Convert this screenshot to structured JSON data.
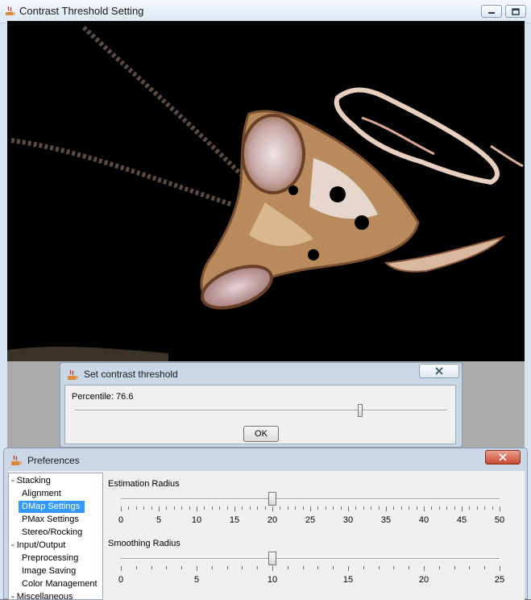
{
  "main_window": {
    "title": "Contrast Threshold Setting"
  },
  "contrast_dialog": {
    "title": "Set contrast threshold",
    "percentile_label": "Percentile: 76.6",
    "percentile_value": 76.6,
    "ok_label": "OK"
  },
  "preferences": {
    "title": "Preferences",
    "tree": [
      {
        "label": "- Stacking",
        "indent": 0,
        "selected": false
      },
      {
        "label": "Alignment",
        "indent": 1,
        "selected": false
      },
      {
        "label": "DMap Settings",
        "indent": 1,
        "selected": true
      },
      {
        "label": "PMax Settings",
        "indent": 1,
        "selected": false
      },
      {
        "label": "Stereo/Rocking",
        "indent": 1,
        "selected": false
      },
      {
        "label": "- Input/Output",
        "indent": 0,
        "selected": false
      },
      {
        "label": "Preprocessing",
        "indent": 1,
        "selected": false
      },
      {
        "label": "Image Saving",
        "indent": 1,
        "selected": false
      },
      {
        "label": "Color Management",
        "indent": 1,
        "selected": false
      },
      {
        "label": "- Miscellaneous",
        "indent": 0,
        "selected": false
      }
    ],
    "estimation_radius": {
      "label": "Estimation Radius",
      "min": 0,
      "max": 50,
      "value": 20,
      "tick_labels": [
        "0",
        "5",
        "10",
        "15",
        "20",
        "25",
        "30",
        "35",
        "40",
        "45",
        "50"
      ],
      "minor_ticks": 51
    },
    "smoothing_radius": {
      "label": "Smoothing Radius",
      "min": 0,
      "max": 25,
      "value": 10,
      "tick_labels": [
        "0",
        "5",
        "10",
        "15",
        "20",
        "25"
      ],
      "minor_ticks": 26
    }
  },
  "colors": {
    "selection": "#3399ff",
    "close_button": "#c84a30"
  }
}
